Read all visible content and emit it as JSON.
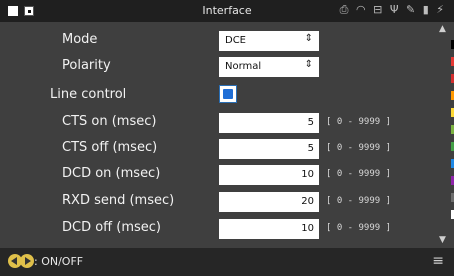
{
  "header": {
    "title": "Interface"
  },
  "status_icons": [
    {
      "name": "printer-icon",
      "glyph": "⎙"
    },
    {
      "name": "wifi-icon",
      "glyph": "◠"
    },
    {
      "name": "network-icon",
      "glyph": "⊟"
    },
    {
      "name": "usb-icon",
      "glyph": "Ψ"
    },
    {
      "name": "tool-icon",
      "glyph": "✎"
    },
    {
      "name": "sdcard-icon",
      "glyph": "▮"
    },
    {
      "name": "power-plug-icon",
      "glyph": "⚡"
    }
  ],
  "form": {
    "mode": {
      "label": "Mode",
      "value": "DCE"
    },
    "polarity": {
      "label": "Polarity",
      "value": "Normal"
    },
    "line_control": {
      "label": "Line control",
      "checked": true
    },
    "cts_on": {
      "label": "CTS on (msec)",
      "value": "5",
      "range": "[ 0 - 9999 ]"
    },
    "cts_off": {
      "label": "CTS off (msec)",
      "value": "5",
      "range": "[ 0 - 9999 ]"
    },
    "dcd_on": {
      "label": "DCD on (msec)",
      "value": "10",
      "range": "[ 0 - 9999 ]"
    },
    "rxd_send": {
      "label": "RXD send (msec)",
      "value": "20",
      "range": "[ 0 - 9999 ]"
    },
    "dcd_off": {
      "label": "DCD off (msec)",
      "value": "10",
      "range": "[ 0 - 9999 ]"
    }
  },
  "side_colors": [
    "#000000",
    "#e53935",
    "#d32f2f",
    "#ff9800",
    "#fdd835",
    "#7cb342",
    "#43a047",
    "#1e88e5",
    "#8e24aa",
    "#6d6d6d",
    "#ffffff"
  ],
  "footer": {
    "hint": ": ON/OFF"
  }
}
